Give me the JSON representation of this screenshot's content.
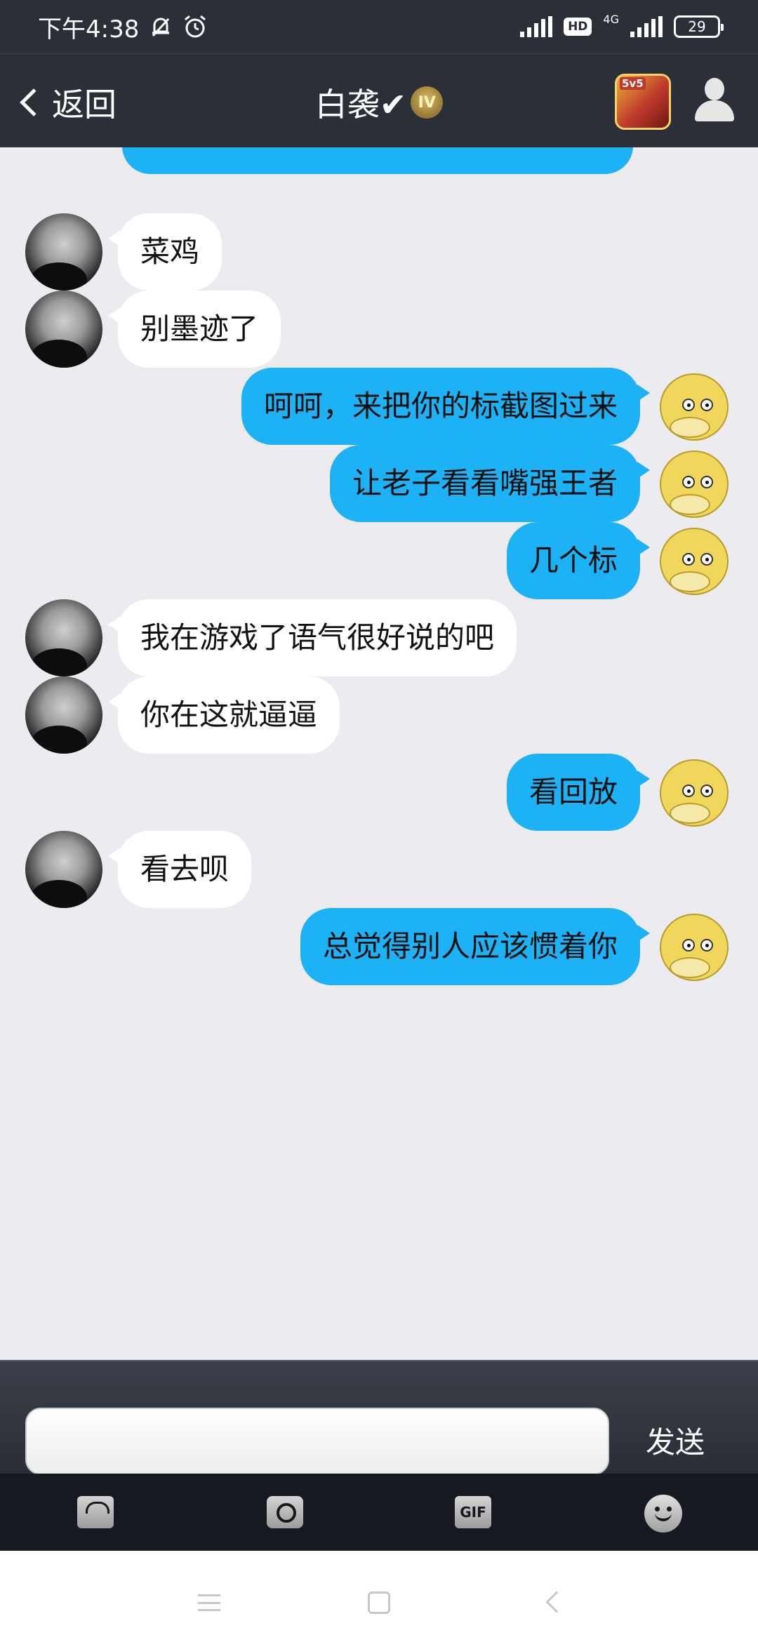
{
  "status_bar": {
    "time": "下午4:38",
    "bell_icon": "bell-off-icon",
    "alarm_icon": "alarm-icon",
    "hd_label": "HD",
    "network": "4G",
    "battery": "29"
  },
  "nav": {
    "back_label": "返回",
    "title": "白袭✔",
    "badge_text": "IV",
    "game_icon_label": "5v5"
  },
  "messages": [
    {
      "side": "left",
      "text": "菜鸡"
    },
    {
      "side": "left",
      "text": "别墨迹了"
    },
    {
      "side": "right",
      "text": "呵呵，来把你的标截图过来"
    },
    {
      "side": "right",
      "text": "让老子看看嘴强王者"
    },
    {
      "side": "right",
      "text": "几个标"
    },
    {
      "side": "left",
      "text": "我在游戏了语气很好说的吧"
    },
    {
      "side": "left",
      "text": "你在这就逼逼"
    },
    {
      "side": "right",
      "text": "看回放"
    },
    {
      "side": "left",
      "text": "看去呗"
    },
    {
      "side": "right",
      "text": "总觉得别人应该惯着你"
    }
  ],
  "input": {
    "value": "",
    "placeholder": "",
    "send_label": "发送"
  },
  "toolbar": {
    "gif_label": "GIF",
    "items": [
      "photo-icon",
      "camera-icon",
      "gif-icon",
      "emoji-icon"
    ]
  },
  "colors": {
    "header_bg": "#2b2f38",
    "chat_bg": "#ebebf0",
    "outgoing_bubble": "#1db1f5",
    "incoming_bubble": "#ffffff"
  }
}
